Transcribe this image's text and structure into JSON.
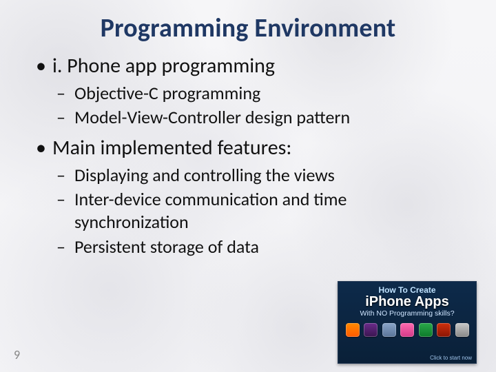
{
  "title": "Programming Environment",
  "bullets": [
    {
      "text": "i. Phone app programming",
      "sub": [
        "Objective-C programming",
        "Model-View-Controller design pattern"
      ]
    },
    {
      "text": "Main implemented features:",
      "sub": [
        " Displaying and controlling the views",
        " Inter-device communication and time synchronization",
        "Persistent storage of data"
      ]
    }
  ],
  "page_number": "9",
  "promo": {
    "line1": "How To Create",
    "line2": "iPhone Apps",
    "line3": "With NO Programming skills?",
    "cta": "Click to start now"
  }
}
